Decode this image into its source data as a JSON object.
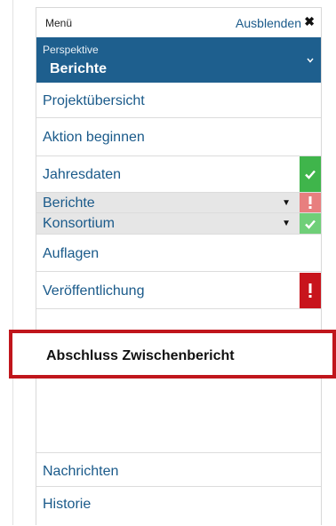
{
  "header": {
    "title": "Menü",
    "hide_label": "Ausblenden",
    "close_symbol": "✖"
  },
  "perspective": {
    "label": "Perspektive",
    "value": "Berichte"
  },
  "items": [
    {
      "label": "Projektübersicht"
    },
    {
      "label": "Aktion beginnen"
    },
    {
      "label": "Jahresdaten",
      "status": "ok"
    },
    {
      "label": "Berichte",
      "status": "error",
      "expandable": true
    },
    {
      "label": "Konsortium",
      "status": "ok",
      "expandable": true
    },
    {
      "label": "Auflagen"
    },
    {
      "label": "Veröffentlichung",
      "status": "error"
    },
    {
      "label": "Abschluss Zwischenbericht",
      "highlighted": true
    },
    {
      "label": "Nachrichten"
    },
    {
      "label": "Historie"
    }
  ],
  "colors": {
    "accent_blue": "#1e5f8e",
    "ok_green": "#3fb54b",
    "error_red": "#c8141c",
    "highlight_red": "#c0161c"
  }
}
